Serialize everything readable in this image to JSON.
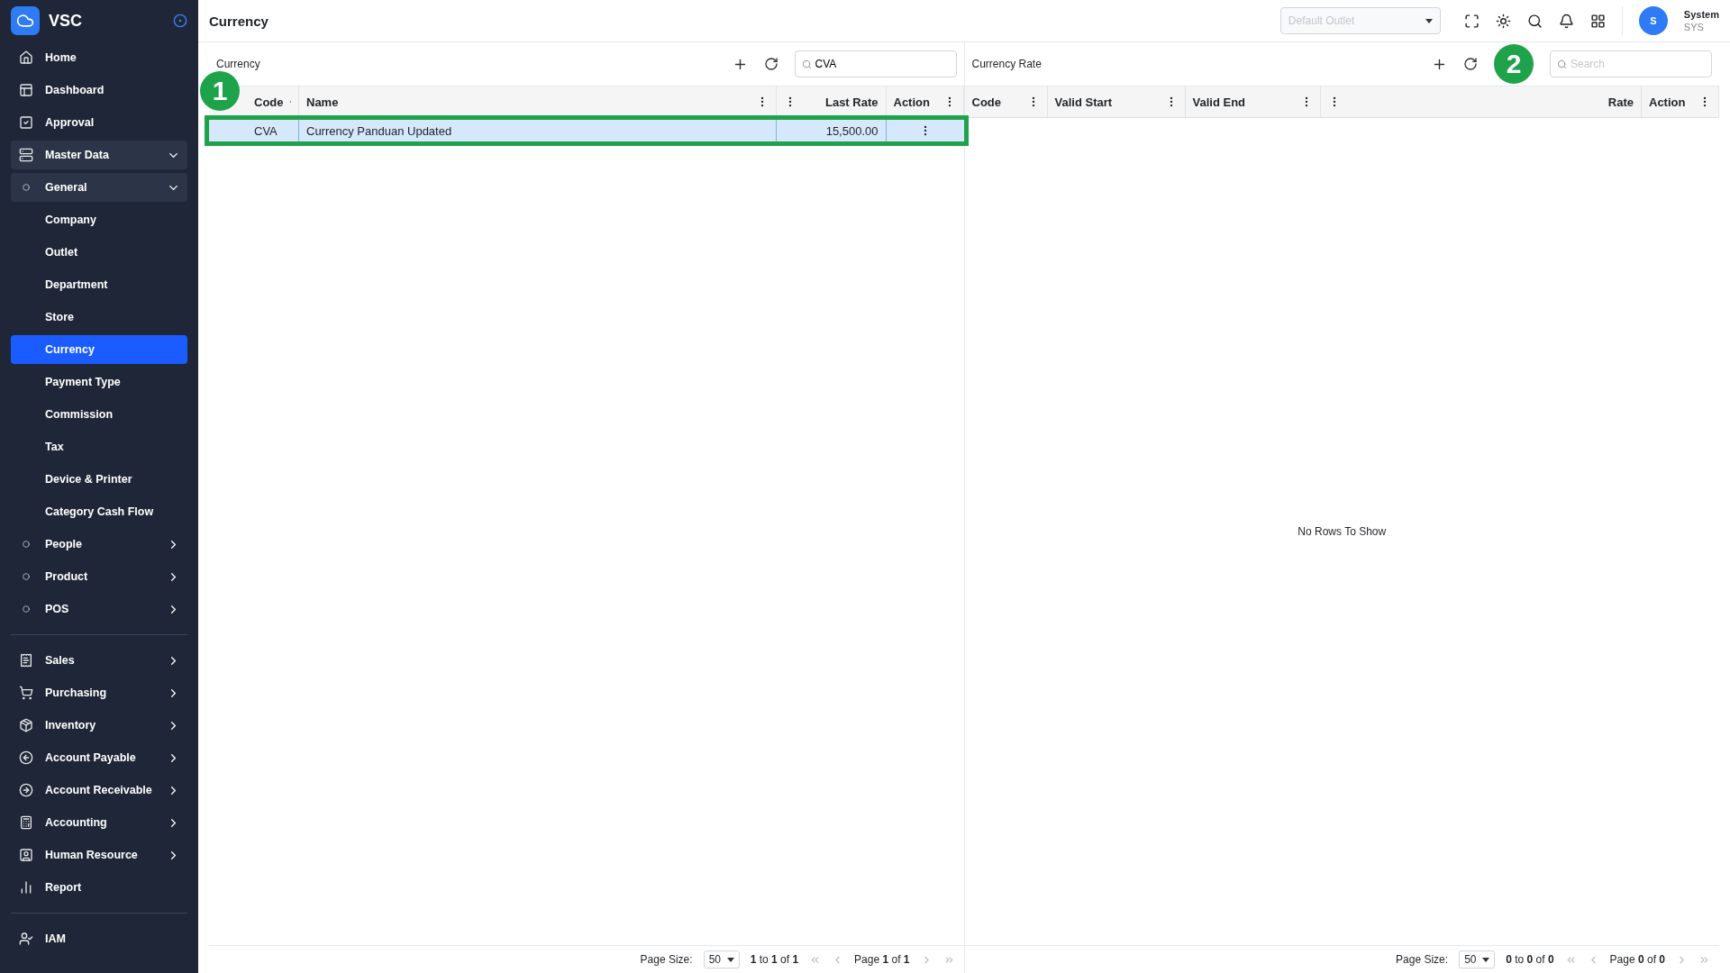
{
  "brand": {
    "name": "VSC"
  },
  "sidebar": {
    "sections": [
      {
        "items": [
          {
            "label": "Home",
            "selected": false
          },
          {
            "label": "Dashboard",
            "selected": false
          },
          {
            "label": "Approval",
            "selected": false
          },
          {
            "label": "Master Data",
            "selected": false,
            "expanded": true,
            "children": [
              {
                "label": "General",
                "selected": false,
                "expanded": true,
                "children": [
                  {
                    "label": "Company",
                    "selected": false
                  },
                  {
                    "label": "Outlet",
                    "selected": false
                  },
                  {
                    "label": "Department",
                    "selected": false
                  },
                  {
                    "label": "Store",
                    "selected": false
                  },
                  {
                    "label": "Currency",
                    "selected": true
                  },
                  {
                    "label": "Payment Type",
                    "selected": false
                  },
                  {
                    "label": "Commission",
                    "selected": false
                  },
                  {
                    "label": "Tax",
                    "selected": false
                  },
                  {
                    "label": "Device & Printer",
                    "selected": false
                  },
                  {
                    "label": "Category Cash Flow",
                    "selected": false
                  }
                ]
              },
              {
                "label": "People",
                "selected": false,
                "expanded": false
              },
              {
                "label": "Product",
                "selected": false,
                "expanded": false
              },
              {
                "label": "POS",
                "selected": false,
                "expanded": false
              }
            ]
          }
        ]
      },
      {
        "items": [
          {
            "label": "Sales",
            "selected": false,
            "expanded": false
          },
          {
            "label": "Purchasing",
            "selected": false,
            "expanded": false
          },
          {
            "label": "Inventory",
            "selected": false,
            "expanded": false
          },
          {
            "label": "Account Payable",
            "selected": false,
            "expanded": false
          },
          {
            "label": "Account Receivable",
            "selected": false,
            "expanded": false
          },
          {
            "label": "Accounting",
            "selected": false,
            "expanded": false
          },
          {
            "label": "Human Resource",
            "selected": false,
            "expanded": false
          },
          {
            "label": "Report",
            "selected": false
          }
        ]
      },
      {
        "items": [
          {
            "label": "IAM",
            "selected": false
          }
        ]
      }
    ]
  },
  "topbar": {
    "title": "Currency",
    "outlet_select": {
      "placeholder": "Default Outlet"
    },
    "user": {
      "initial": "S",
      "name": "System",
      "code": "SYS"
    }
  },
  "panels": [
    {
      "title": "Currency",
      "search": {
        "value": "CVA"
      },
      "columns": [
        {
          "label": "Code",
          "kind": "text"
        },
        {
          "label": "Name",
          "kind": "text"
        },
        {
          "label": "Last Rate",
          "kind": "number"
        },
        {
          "label": "Action",
          "kind": "text"
        }
      ],
      "rows": [
        {
          "cells": [
            "CVA",
            "Currency Panduan Updated",
            "15,500.00"
          ],
          "selected": true,
          "outlined": true
        }
      ],
      "pagination": {
        "page_size_label": "Page Size:",
        "page_size": "50",
        "range": "**1** to **1** of **1**",
        "page": "Page **1** of **1**"
      }
    },
    {
      "title": "Currency Rate",
      "search": {
        "placeholder": "Search"
      },
      "columns": [
        {
          "label": "Code",
          "kind": "text"
        },
        {
          "label": "Valid Start",
          "kind": "text"
        },
        {
          "label": "Valid End",
          "kind": "text"
        },
        {
          "label": "Rate",
          "kind": "number"
        },
        {
          "label": "Action",
          "kind": "text"
        }
      ],
      "empty_text": "No Rows To Show",
      "pagination": {
        "page_size_label": "Page Size:",
        "page_size": "50",
        "range": "**0** to **0** of **0**",
        "page": "Page **0** of **0**"
      }
    }
  ],
  "callouts": [
    {
      "label": "1"
    },
    {
      "label": "2"
    }
  ]
}
